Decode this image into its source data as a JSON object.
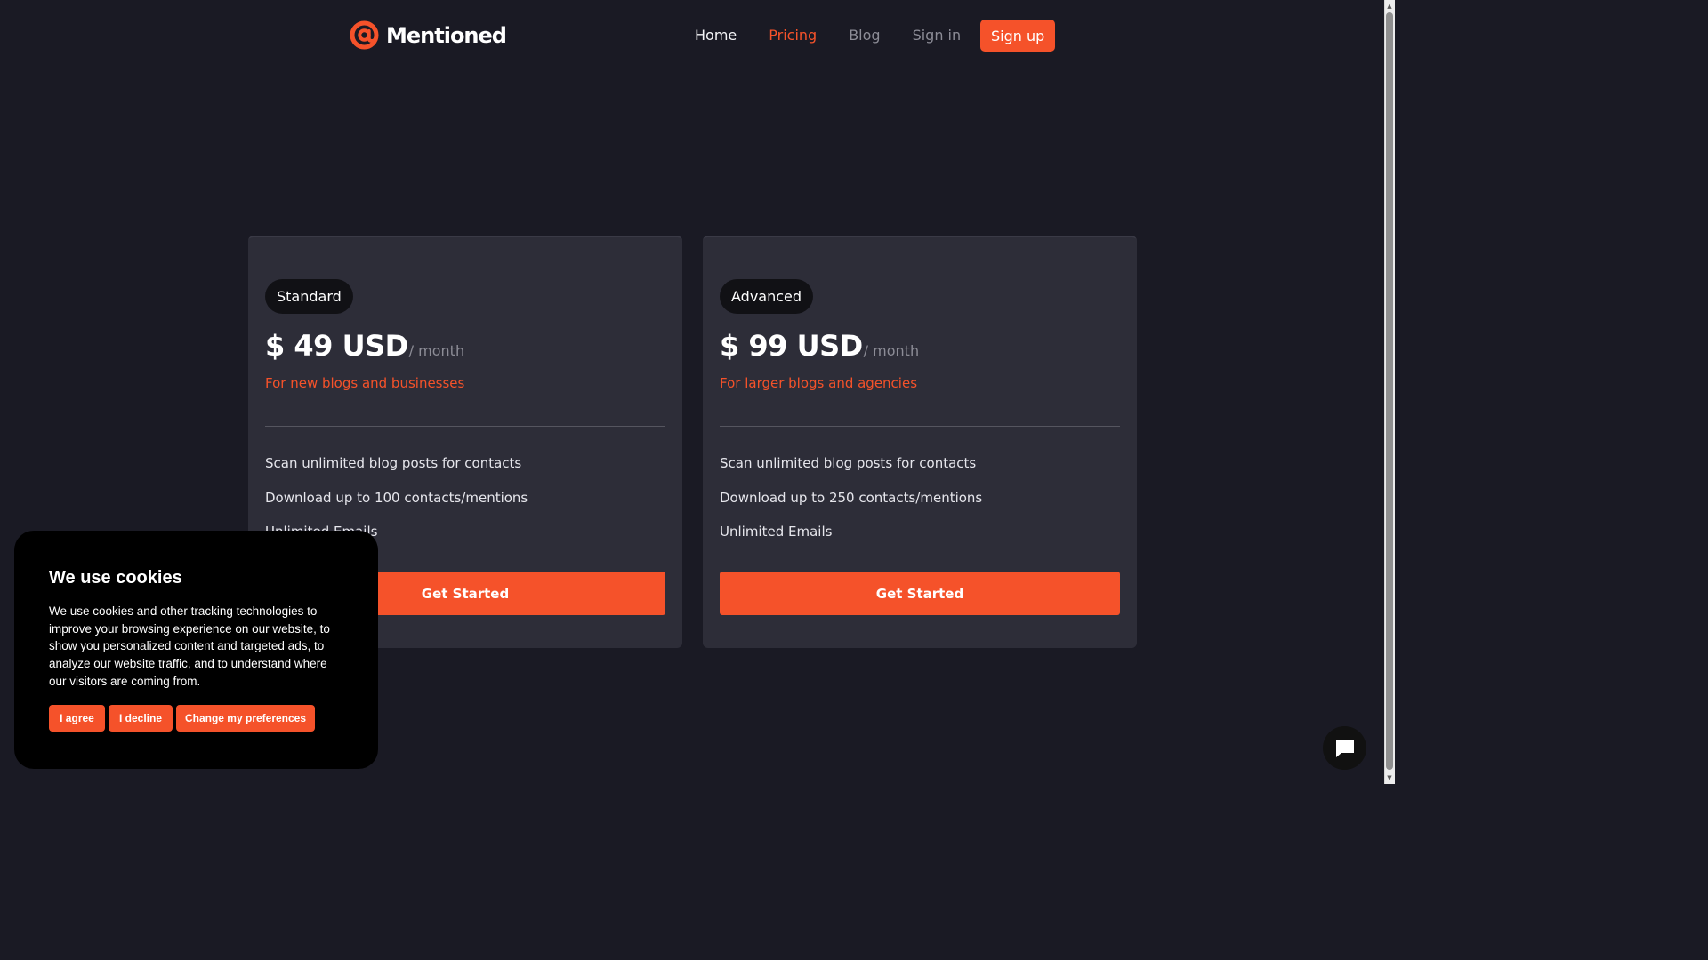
{
  "header": {
    "brand": "Mentioned",
    "logo_icon": "at-sign-icon",
    "nav": {
      "home": "Home",
      "pricing": "Pricing",
      "blog": "Blog",
      "sign_in": "Sign in",
      "sign_up": "Sign up"
    }
  },
  "plans": [
    {
      "badge": "Standard",
      "price": "$ 49 USD",
      "period": "/ month",
      "tagline": "For new blogs and businesses",
      "features": [
        "Scan unlimited blog posts for contacts",
        "Download up to 100 contacts/mentions",
        "Unlimited Emails"
      ],
      "cta": "Get Started"
    },
    {
      "badge": "Advanced",
      "price": "$ 99 USD",
      "period": "/ month",
      "tagline": "For larger blogs and agencies",
      "features": [
        "Scan unlimited blog posts for contacts",
        "Download up to 250 contacts/mentions",
        "Unlimited Emails"
      ],
      "cta": "Get Started"
    }
  ],
  "cookie_banner": {
    "title": "We use cookies",
    "text": "We use cookies and other tracking technologies to improve your browsing experience on our website, to show you personalized content and targeted ads, to analyze our website traffic, and to understand where our visitors are coming from.",
    "agree": "I agree",
    "decline": "I decline",
    "preferences": "Change my preferences"
  },
  "chat_widget": {
    "icon": "chat-bubble-icon"
  },
  "colors": {
    "accent": "#f5522a",
    "background": "#1a1a24",
    "card": "#2d2d38"
  }
}
